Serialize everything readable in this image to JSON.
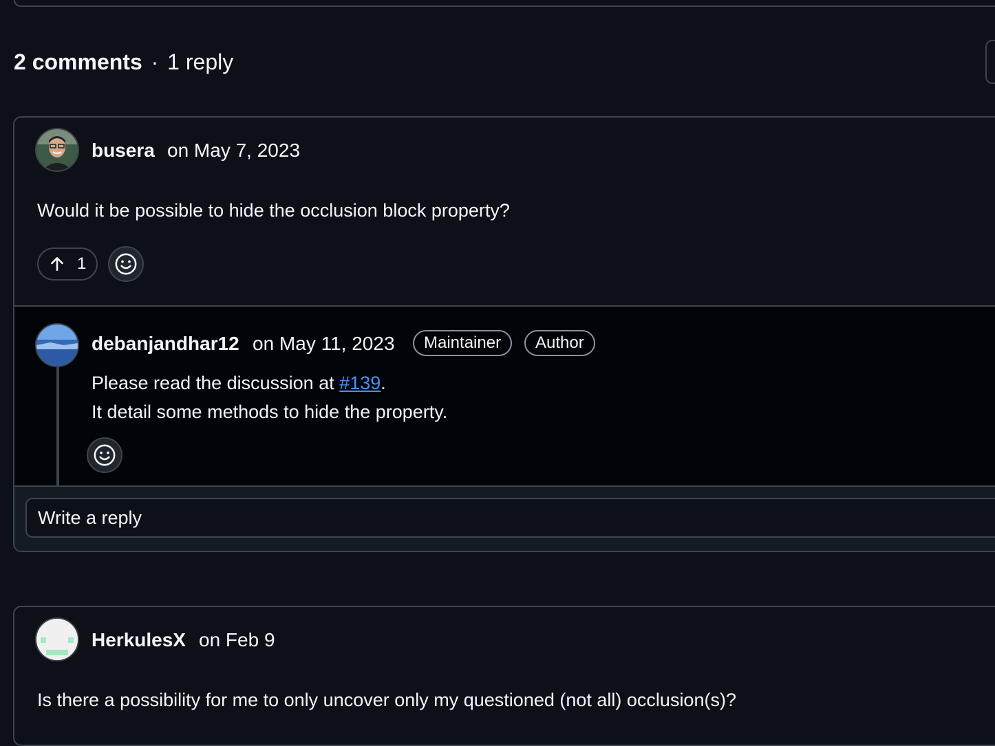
{
  "header": {
    "comments_count": "2 comments",
    "separator": "·",
    "replies_count": "1 reply"
  },
  "thread1": {
    "comment": {
      "author": "busera",
      "date": "on May 7, 2023",
      "body": "Would it be possible to hide the occlusion block property?",
      "upvotes": "1"
    },
    "reply": {
      "author": "debanjandhar12",
      "date": "on May 11, 2023",
      "badges": [
        "Maintainer",
        "Author"
      ],
      "line1_prefix": "Please read the discussion at ",
      "line1_link": "#139",
      "line1_suffix": ".",
      "line2": "It detail some methods to hide the property."
    },
    "reply_placeholder": "Write a reply"
  },
  "thread2": {
    "comment": {
      "author": "HerkulesX",
      "date": "on Feb 9",
      "body": "Is there a possibility for me to only uncover only my questioned (not all) occlusion(s)?"
    }
  },
  "colors": {
    "background": "#0d1117",
    "reply_background": "#010409",
    "border": "#3d444d",
    "link": "#4493f8",
    "text": "#f0f6fc"
  }
}
